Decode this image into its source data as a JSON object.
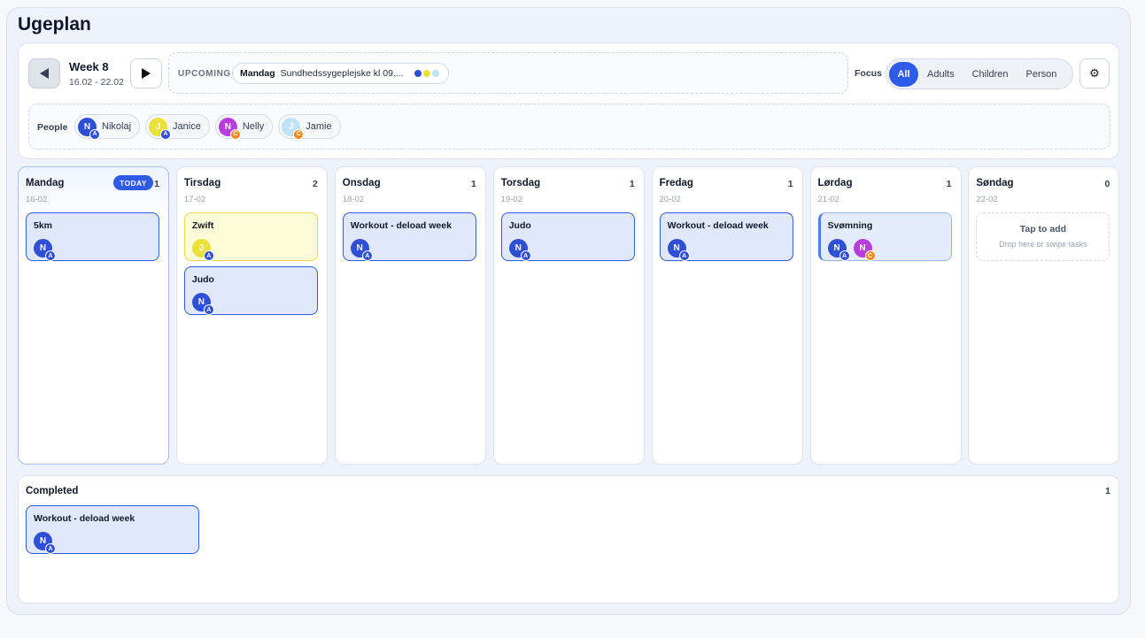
{
  "page": {
    "title": "Ugeplan"
  },
  "colors": {
    "accent": "#2f5bea",
    "adult": "#2f4fd6",
    "child": "#f08a1c"
  },
  "nav": {
    "week_label": "Week 8",
    "week_range": "16.02 - 22.02",
    "prev_icon": "chevron-left-icon",
    "next_icon": "play-right-icon"
  },
  "upcoming": {
    "title": "UPCOMING",
    "day": "Mandag",
    "text": "Sundhedssygeplejske kl 09....",
    "dots": [
      "#2f4fd6",
      "#ece13a",
      "#bfe4f7"
    ]
  },
  "focus": {
    "label": "Focus",
    "options": [
      "All",
      "Adults",
      "Children",
      "Person"
    ],
    "selected": "All"
  },
  "settings": {
    "icon": "gear-icon",
    "glyph": "⚙"
  },
  "people": {
    "label": "People",
    "list": [
      {
        "name": "Nikolaj",
        "initial": "N",
        "color": "#2f4fd6",
        "role": "A"
      },
      {
        "name": "Janice",
        "initial": "J",
        "color": "#ece13a",
        "role": "A"
      },
      {
        "name": "Nelly",
        "initial": "N",
        "color": "#b63ee0",
        "role": "C"
      },
      {
        "name": "Jamie",
        "initial": "J",
        "color": "#bfe4f7",
        "role": "C"
      }
    ]
  },
  "days": [
    {
      "name": "Mandag",
      "date": "16-02",
      "count": "1",
      "today": true,
      "today_label": "TODAY",
      "tasks": [
        {
          "title": "5km",
          "people": [
            0
          ]
        }
      ]
    },
    {
      "name": "Tirsdag",
      "date": "17-02",
      "count": "2",
      "tasks": [
        {
          "title": "Zwift",
          "people": [
            1
          ],
          "style": "yellow"
        },
        {
          "title": "Judo",
          "people": [
            0
          ]
        }
      ]
    },
    {
      "name": "Onsdag",
      "date": "18-02",
      "count": "1",
      "tasks": [
        {
          "title": "Workout - deload week",
          "people": [
            0
          ]
        }
      ]
    },
    {
      "name": "Torsdag",
      "date": "19-02",
      "count": "1",
      "tasks": [
        {
          "title": "Judo",
          "people": [
            0
          ]
        }
      ]
    },
    {
      "name": "Fredag",
      "date": "20-02",
      "count": "1",
      "tasks": [
        {
          "title": "Workout - deload week",
          "people": [
            0
          ]
        }
      ]
    },
    {
      "name": "Lørdag",
      "date": "21-02",
      "count": "1",
      "tasks": [
        {
          "title": "Svømning",
          "people": [
            0,
            2
          ],
          "style": "light"
        }
      ]
    },
    {
      "name": "Søndag",
      "date": "22-02",
      "count": "0",
      "tasks": [],
      "empty_title": "Tap to add",
      "empty_hint": "Drop here or swipe tasks"
    }
  ],
  "completed": {
    "title": "Completed",
    "count": "1",
    "tasks": [
      {
        "title": "Workout - deload week",
        "people": [
          0
        ]
      }
    ]
  }
}
